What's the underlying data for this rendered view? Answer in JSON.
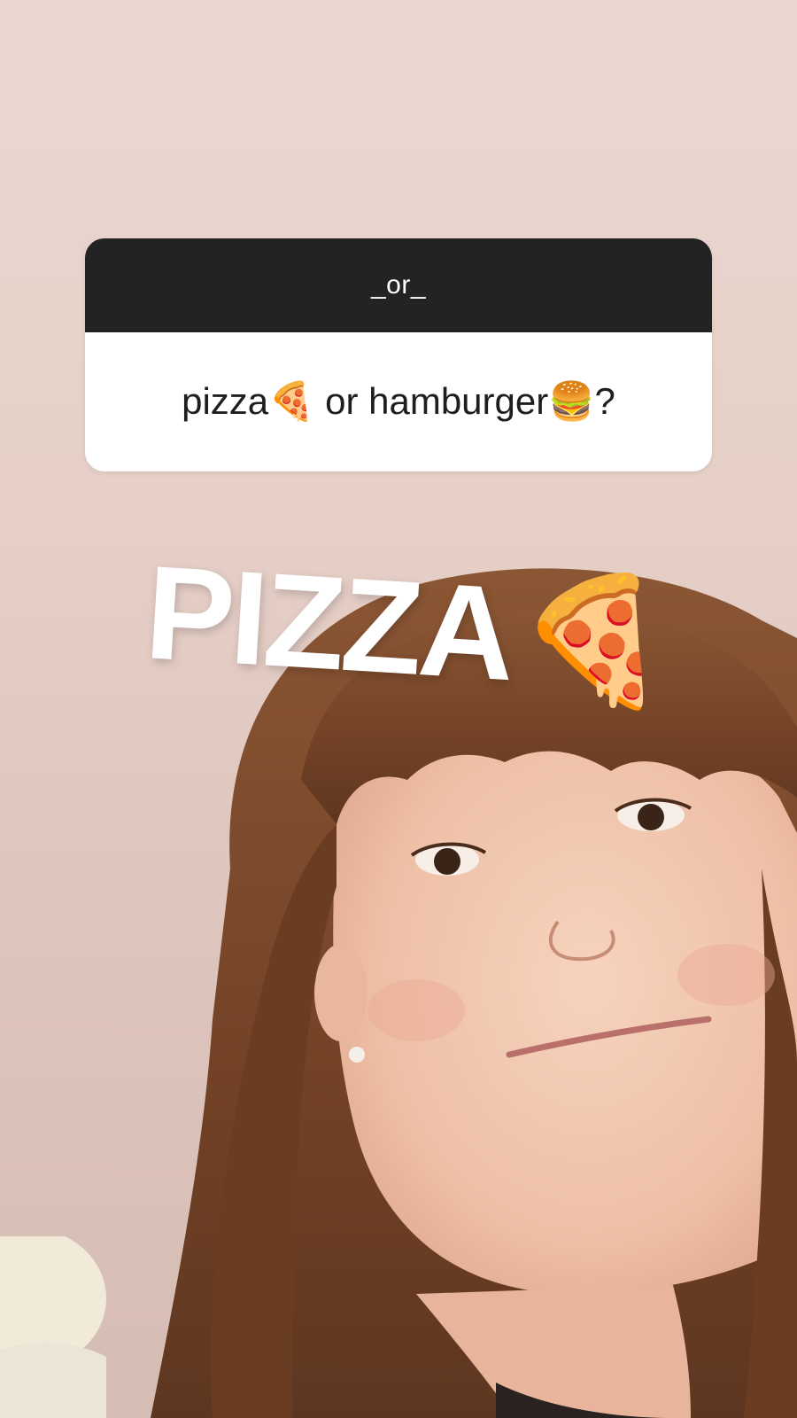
{
  "question": {
    "header": "_or_",
    "text": "pizza🍕 or hamburger🍔?"
  },
  "answer": {
    "text": "PIZZA",
    "emoji": "🍕"
  },
  "colors": {
    "header_bg": "#232323",
    "body_bg": "#ffffff",
    "hair": "#7b4a2c",
    "skin": "#f0c6ae"
  }
}
